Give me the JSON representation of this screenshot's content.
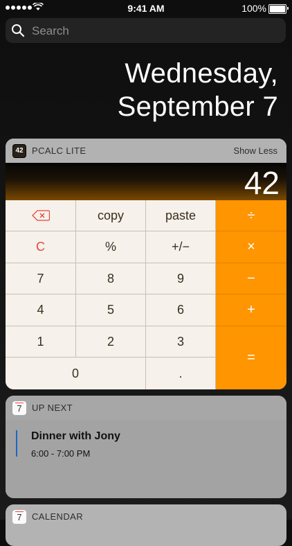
{
  "status_bar": {
    "time": "9:41 AM",
    "battery": "100%"
  },
  "search": {
    "placeholder": "Search"
  },
  "date": {
    "line1": "Wednesday,",
    "line2": "September 7"
  },
  "pcalc": {
    "icon_label": "42",
    "title": "PCALC LITE",
    "show_less": "Show Less",
    "display": "42",
    "keys": {
      "copy": "copy",
      "paste": "paste",
      "divide": "÷",
      "clear": "C",
      "percent": "%",
      "sign": "+/−",
      "multiply": "×",
      "seven": "7",
      "eight": "8",
      "nine": "9",
      "minus": "−",
      "four": "4",
      "five": "5",
      "six": "6",
      "plus": "+",
      "one": "1",
      "two": "2",
      "three": "3",
      "equals": "=",
      "zero": "0",
      "decimal": "."
    }
  },
  "up_next": {
    "icon_day": "7",
    "title": "UP NEXT",
    "event": {
      "title": "Dinner with Jony",
      "time": "6:00 - 7:00 PM"
    }
  },
  "calendar": {
    "icon_day": "7",
    "title": "CALENDAR"
  },
  "colors": {
    "accent_orange": "#ff9500",
    "event_blue": "#1768c6"
  }
}
